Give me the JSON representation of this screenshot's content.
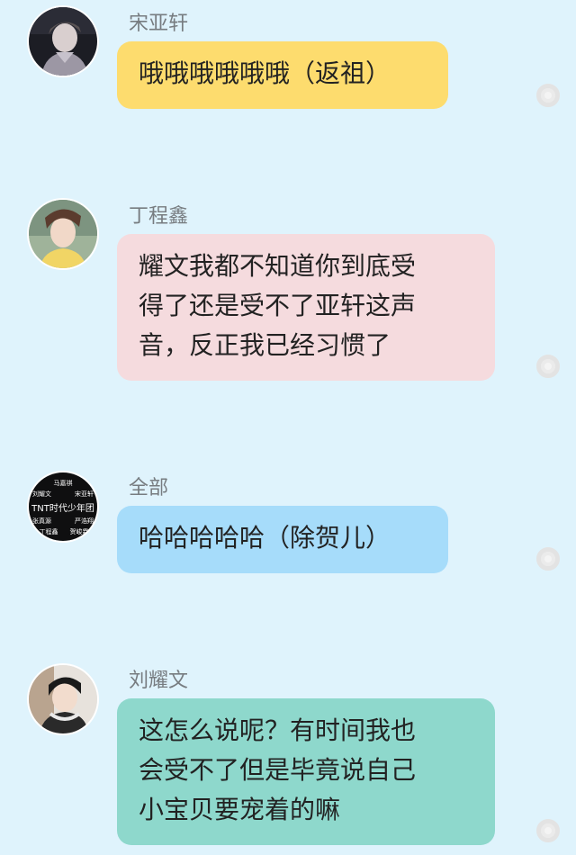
{
  "messages": [
    {
      "sender": "宋亚轩",
      "text": "哦哦哦哦哦哦（返祖）",
      "bubble_color": "#fddc6e",
      "avatar_icon": "avatar-song-yaxuan"
    },
    {
      "sender": "丁程鑫",
      "text": "耀文我都不知道你到底受\n得了还是受不了亚轩这声\n音，反正我已经习惯了",
      "bubble_color": "#f5dbde",
      "avatar_icon": "avatar-ding-chengxin"
    },
    {
      "sender": "全部",
      "text": "哈哈哈哈哈（除贺儿）",
      "bubble_color": "#a6dcfa",
      "avatar_icon": "avatar-group-tnt",
      "avatar_text": {
        "line1": "马嘉祺",
        "line2": "刘耀文",
        "line3": "宋亚轩",
        "line4": "TNT时代少年团",
        "line5": "张真源",
        "line6": "严浩翔",
        "line7": "丁程鑫",
        "line8": "贺峻霖"
      }
    },
    {
      "sender": "刘耀文",
      "text": "这怎么说呢？有时间我也\n会受不了但是毕竟说自己\n小宝贝要宠着的嘛",
      "bubble_color": "#8ed8cc",
      "avatar_icon": "avatar-liu-yaowen"
    }
  ],
  "background_color": "#dff3fc"
}
